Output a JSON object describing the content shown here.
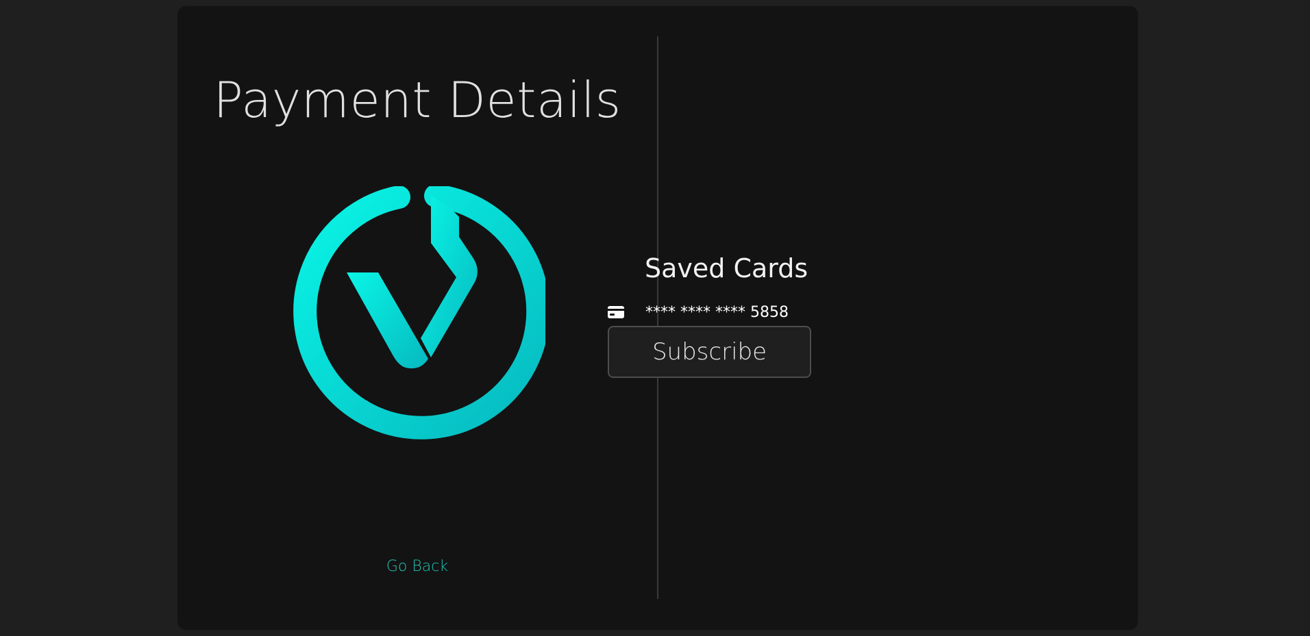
{
  "page": {
    "title": "Payment Details"
  },
  "logo": {
    "icon": "brand-logo-icon",
    "colors": {
      "gradient_start": "#0af5e6",
      "gradient_end": "#06b9c0"
    }
  },
  "navigation": {
    "go_back_label": "Go Back"
  },
  "saved_cards": {
    "title": "Saved Cards",
    "cards": [
      {
        "icon": "credit-card-icon",
        "masked_number": "**** **** **** 5858"
      }
    ]
  },
  "actions": {
    "subscribe_label": "Subscribe"
  },
  "colors": {
    "page_background": "#1f1f1f",
    "card_background": "#131313",
    "accent": "#22c4b8",
    "divider": "#3a3a3a",
    "button_border": "#4d4d4d"
  }
}
